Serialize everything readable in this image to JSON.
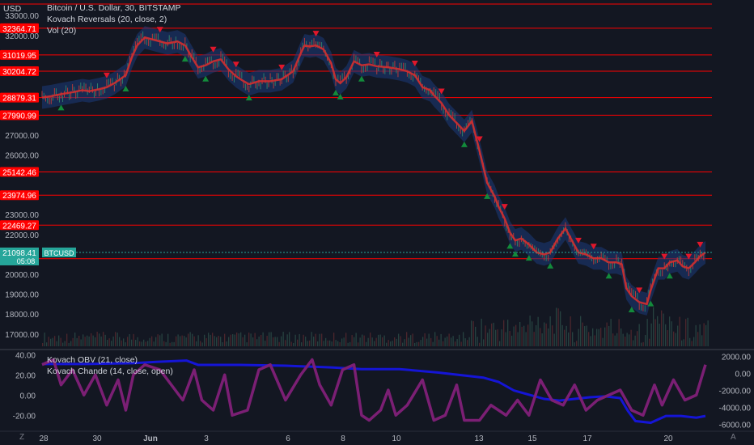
{
  "header": {
    "currency_label": "USD",
    "title_line": "Bitcoin / U.S. Dollar, 30, BITSTAMP",
    "indicator_1": "Kovach Reversals (20, close, 2)",
    "indicator_2": "Vol (20)",
    "lower_indicator_1": "Kovach OBV (21, close)",
    "lower_indicator_2": "Kovach Chande (14, close, open)"
  },
  "icons": {
    "left_corner": "Z",
    "right_corner": "A"
  },
  "colors": {
    "background": "#131722",
    "level_line": "#ff0000",
    "price_band": "#1c3b7a",
    "trend_line": "#d32f2f",
    "up_arrow": "#138a3b",
    "down_arrow": "#e0172b",
    "obv_line": "#1515d6",
    "chande_line": "#7b1f74",
    "current_price_bg": "#26a69a"
  },
  "chart_data": [
    {
      "type": "line",
      "title": "Bitcoin / U.S. Dollar, 30, BITSTAMP",
      "ylabel": "USD",
      "x_ticks": [
        "28",
        "30",
        "Jun",
        "3",
        "6",
        "8",
        "10",
        "13",
        "15",
        "17",
        "20"
      ],
      "y_ticks": [
        17000,
        18000,
        19000,
        20000,
        21000,
        22000,
        23000,
        26000,
        27000,
        32000,
        33000
      ],
      "ylim": [
        16300,
        33700
      ],
      "horizontal_levels": [
        32364.71,
        31019.95,
        30204.72,
        28879.31,
        27990.99,
        25142.46,
        23974.96,
        22469.27,
        20780.43
      ],
      "current_price": {
        "label": "BTCUSD",
        "value": 21098.41,
        "countdown": "05:08"
      },
      "series": [
        {
          "x": [
            0,
            12,
            25,
            40,
            53,
            62,
            75,
            85,
            95,
            110,
            118,
            125,
            135,
            145,
            155,
            165,
            178,
            188,
            197,
            205,
            215,
            225,
            235,
            245,
            255,
            265,
            272,
            285,
            300,
            315,
            330,
            340,
            345,
            352,
            360,
            370,
            380,
            386,
            392,
            400,
            410,
            420,
            430,
            440,
            455,
            470,
            480,
            490,
            500,
            510,
            515,
            525,
            535,
            545,
            555,
            565,
            575,
            585,
            595,
            600,
            608,
            615,
            622,
            630,
            640,
            650,
            660,
            668,
            678,
            688,
            695,
            705,
            715,
            725,
            735,
            745,
            755,
            762,
            768,
            775,
            785,
            795,
            800,
            810,
            818,
            825,
            835,
            842,
            850,
            858,
            865,
            872
          ],
          "values": [
            28880,
            28950,
            29050,
            29150,
            29250,
            29200,
            29300,
            29400,
            29600,
            30000,
            30900,
            31500,
            31900,
            31800,
            31700,
            31600,
            31700,
            31500,
            30900,
            30400,
            30500,
            30700,
            30800,
            30300,
            29950,
            29700,
            29550,
            29700,
            29700,
            29800,
            30200,
            31100,
            31500,
            31450,
            31500,
            31300,
            30600,
            29800,
            29600,
            29900,
            30700,
            30500,
            30550,
            30450,
            30400,
            30300,
            30200,
            30000,
            29400,
            29250,
            29000,
            28600,
            28000,
            27600,
            27200,
            27700,
            26200,
            24600,
            23900,
            23400,
            22800,
            22100,
            21700,
            21800,
            21500,
            21100,
            21000,
            21100,
            21800,
            22300,
            21800,
            21100,
            21000,
            20800,
            20800,
            20600,
            20600,
            20500,
            19300,
            18900,
            18600,
            18500,
            19200,
            20300,
            20300,
            20600,
            20700,
            20400,
            20300,
            20600,
            20900,
            21100
          ]
        }
      ]
    },
    {
      "type": "line",
      "title": "Kovach OBV (21, close)",
      "y_ticks": [
        40.0,
        20.0,
        0.0,
        -20.0
      ],
      "right_ticks": [
        2000.0,
        0.0,
        -2000.0,
        -4000.0,
        -6000.0
      ],
      "series": [
        {
          "name": "Kovach OBV (21, close)",
          "x": [
            0,
            60,
            120,
            150,
            190,
            205,
            260,
            320,
            380,
            420,
            470,
            520,
            540,
            560,
            580,
            600,
            620,
            640,
            660,
            680,
            700,
            720,
            740,
            760,
            770,
            780,
            800,
            820,
            840,
            860,
            872
          ],
          "values": [
            1100,
            1100,
            1200,
            1350,
            1500,
            1000,
            1000,
            900,
            700,
            500,
            500,
            100,
            -100,
            -300,
            -500,
            -1000,
            -2000,
            -2500,
            -3000,
            -3200,
            -3000,
            -2800,
            -2700,
            -2900,
            -4400,
            -5600,
            -5800,
            -5000,
            -5000,
            -5200,
            -5000
          ]
        },
        {
          "name": "Kovach Chande (14, close, open)",
          "x": [
            0,
            15,
            25,
            40,
            55,
            70,
            85,
            100,
            110,
            120,
            135,
            155,
            170,
            185,
            200,
            210,
            225,
            240,
            250,
            270,
            285,
            300,
            320,
            340,
            355,
            365,
            380,
            395,
            410,
            420,
            430,
            445,
            455,
            465,
            480,
            500,
            515,
            530,
            545,
            555,
            575,
            590,
            610,
            625,
            640,
            655,
            670,
            685,
            700,
            715,
            730,
            745,
            760,
            775,
            790,
            805,
            815,
            830,
            845,
            860,
            872
          ],
          "values": [
            30,
            35,
            10,
            25,
            0,
            20,
            -10,
            15,
            -15,
            20,
            30,
            25,
            10,
            -5,
            25,
            -5,
            -15,
            20,
            -20,
            -15,
            25,
            30,
            -5,
            20,
            35,
            10,
            -10,
            25,
            30,
            -20,
            -25,
            -15,
            5,
            -20,
            -10,
            15,
            -25,
            -20,
            10,
            -25,
            -25,
            -10,
            -20,
            -5,
            -20,
            15,
            -5,
            -10,
            10,
            -15,
            -5,
            0,
            5,
            -15,
            -20,
            10,
            -10,
            15,
            -5,
            0,
            30
          ]
        }
      ]
    }
  ],
  "x_axis": {
    "ticks": [
      "28",
      "30",
      "Jun",
      "3",
      "6",
      "8",
      "10",
      "13",
      "15",
      "17",
      "20"
    ]
  }
}
